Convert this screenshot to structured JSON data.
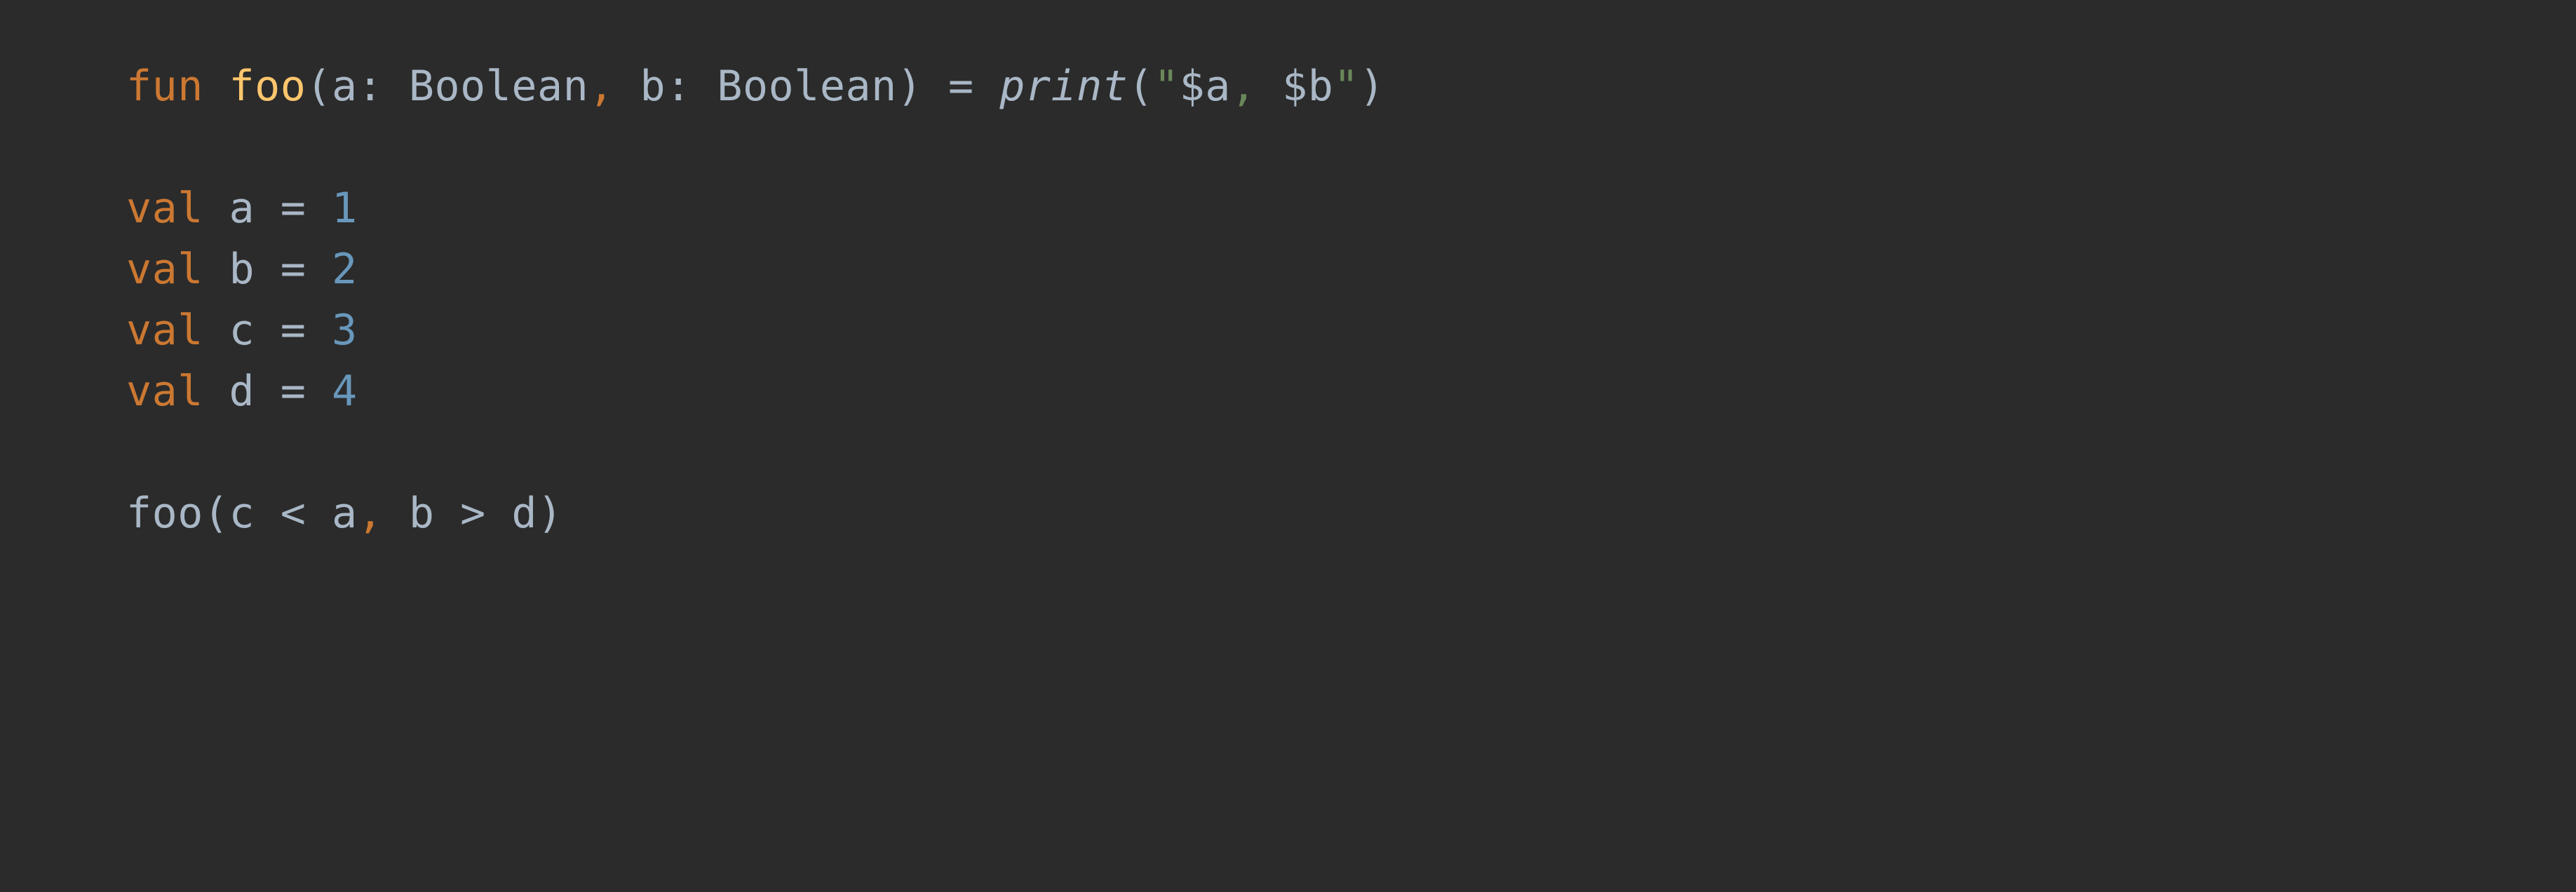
{
  "code": {
    "line1": {
      "kw_fun": "fun",
      "sp1": " ",
      "fn_name": "foo",
      "lparen": "(",
      "param_a": "a",
      "colon1": ": ",
      "type1": "Boolean",
      "comma1": ",",
      "sp2": " ",
      "param_b": "b",
      "colon2": ": ",
      "type2": "Boolean",
      "rparen": ")",
      "sp3": " ",
      "eq": "=",
      "sp4": " ",
      "call_print": "print",
      "lparen2": "(",
      "q1": "\"",
      "tpl_a": "$a",
      "str_mid": ", ",
      "tpl_b": "$b",
      "q2": "\"",
      "rparen2": ")"
    },
    "line3": {
      "kw_val": "val",
      "sp": " ",
      "name": "a",
      "sp2": " ",
      "eq": "=",
      "sp3": " ",
      "num": "1"
    },
    "line4": {
      "kw_val": "val",
      "sp": " ",
      "name": "b",
      "sp2": " ",
      "eq": "=",
      "sp3": " ",
      "num": "2"
    },
    "line5": {
      "kw_val": "val",
      "sp": " ",
      "name": "c",
      "sp2": " ",
      "eq": "=",
      "sp3": " ",
      "num": "3"
    },
    "line6": {
      "kw_val": "val",
      "sp": " ",
      "name": "d",
      "sp2": " ",
      "eq": "=",
      "sp3": " ",
      "num": "4"
    },
    "line8": {
      "call": "foo",
      "lparen": "(",
      "expr1a": "c ",
      "lt": "<",
      "expr1b": " a",
      "comma": ",",
      "sp": " ",
      "expr2a": "b ",
      "gt": ">",
      "expr2b": " d",
      "rparen": ")"
    }
  },
  "colors": {
    "background": "#2b2b2b",
    "default_text": "#a9b7c6",
    "keyword": "#cc7832",
    "function_decl": "#ffc66d",
    "string": "#6a8759",
    "number": "#6897bb"
  }
}
